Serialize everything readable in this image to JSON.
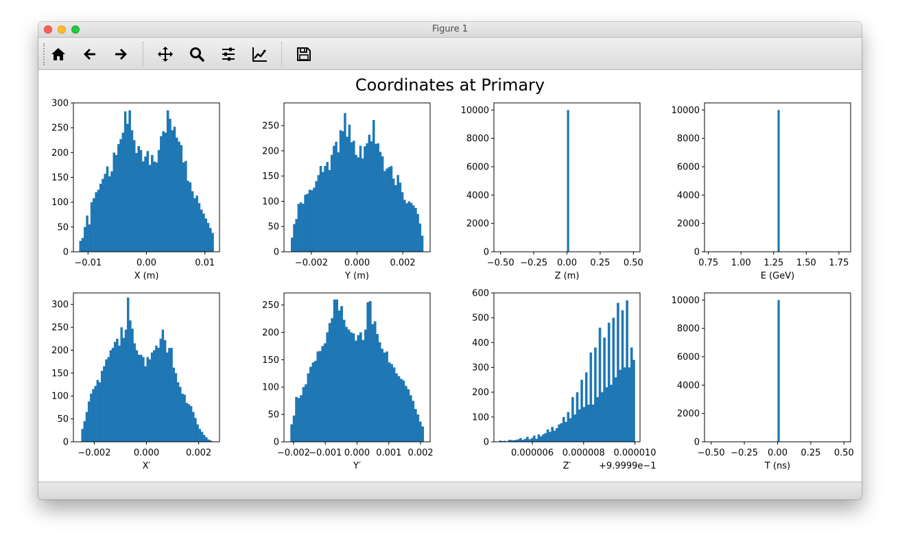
{
  "window": {
    "title": "Figure 1"
  },
  "toolbar": {
    "buttons": [
      {
        "icon": "home-icon"
      },
      {
        "icon": "back-arrow-icon"
      },
      {
        "icon": "forward-arrow-icon"
      },
      {
        "icon": "pan-move-icon"
      },
      {
        "icon": "zoom-magnifier-icon"
      },
      {
        "icon": "configure-subplots-icon"
      },
      {
        "icon": "edit-axis-curve-icon"
      },
      {
        "icon": "save-floppy-icon"
      }
    ]
  },
  "colors": {
    "bar": "#1f77b4"
  },
  "figure": {
    "title": "Coordinates at Primary"
  },
  "chart_data": [
    {
      "type": "bar",
      "xlabel": "X (m)",
      "xlim": [
        -0.0125,
        0.0125
      ],
      "ylim": [
        0,
        300
      ],
      "xticks": [
        -0.01,
        0.0,
        0.01
      ],
      "xticklabels": [
        "−0.01",
        "0.00",
        "0.01"
      ],
      "yticks": [
        0,
        50,
        100,
        150,
        200,
        250,
        300
      ],
      "bins_range": [
        -0.0115,
        0.0115
      ],
      "values": [
        22,
        28,
        50,
        73,
        55,
        100,
        108,
        120,
        125,
        137,
        147,
        157,
        172,
        152,
        162,
        200,
        195,
        217,
        227,
        240,
        283,
        258,
        285,
        245,
        225,
        199,
        213,
        205,
        182,
        192,
        203,
        175,
        195,
        182,
        180,
        205,
        233,
        243,
        240,
        285,
        268,
        245,
        252,
        230,
        222,
        215,
        180,
        183,
        143,
        140,
        122,
        108,
        113,
        98,
        85,
        77,
        67,
        58,
        48,
        38
      ]
    },
    {
      "type": "bar",
      "xlabel": "Y (m)",
      "xlim": [
        -0.0032,
        0.0032
      ],
      "ylim": [
        0,
        295
      ],
      "xticks": [
        -0.002,
        0.0,
        0.002
      ],
      "xticklabels": [
        "−0.002",
        "0.000",
        "0.002"
      ],
      "yticks": [
        0,
        50,
        100,
        150,
        200,
        250
      ],
      "bins_range": [
        -0.0029,
        0.0029
      ],
      "values": [
        28,
        55,
        65,
        95,
        98,
        95,
        113,
        115,
        123,
        122,
        127,
        140,
        152,
        170,
        158,
        170,
        178,
        162,
        192,
        210,
        218,
        197,
        241,
        239,
        275,
        228,
        252,
        217,
        220,
        192,
        187,
        210,
        185,
        209,
        215,
        232,
        219,
        261,
        214,
        215,
        198,
        189,
        160,
        165,
        168,
        170,
        145,
        132,
        152,
        137,
        118,
        103,
        96,
        100,
        97,
        92,
        87,
        75,
        56,
        32
      ]
    },
    {
      "type": "bar",
      "xlabel": "Z (m)",
      "xlim": [
        -0.55,
        0.55
      ],
      "ylim": [
        0,
        10500
      ],
      "xticks": [
        -0.5,
        -0.25,
        0.0,
        0.25,
        0.5
      ],
      "xticklabels": [
        "−0.50",
        "−0.25",
        "0.00",
        "0.25",
        "0.50"
      ],
      "yticks": [
        0,
        2000,
        4000,
        6000,
        8000,
        10000
      ],
      "bins_range": [
        -0.5,
        0.5
      ],
      "spike_at": 0.0,
      "spike_value": 10000,
      "nbins": 60
    },
    {
      "type": "bar",
      "xlabel": "E (GeV)",
      "xlim": [
        0.72,
        1.84
      ],
      "ylim": [
        0,
        10500
      ],
      "xticks": [
        0.75,
        1.0,
        1.25,
        1.5,
        1.75
      ],
      "xticklabels": [
        "0.75",
        "1.00",
        "1.25",
        "1.50",
        "1.75"
      ],
      "yticks": [
        0,
        2000,
        4000,
        6000,
        8000,
        10000
      ],
      "bins_range": [
        0.78,
        1.78
      ],
      "spike_at": 1.28,
      "spike_value": 10000,
      "nbins": 60
    },
    {
      "type": "bar",
      "xlabel": "X′",
      "xlim": [
        -0.0028,
        0.0028
      ],
      "ylim": [
        0,
        325
      ],
      "xticks": [
        -0.002,
        0.0,
        0.002
      ],
      "xticklabels": [
        "−0.002",
        "0.000",
        "0.002"
      ],
      "yticks": [
        0,
        50,
        100,
        150,
        200,
        250,
        300
      ],
      "bins_range": [
        -0.0025,
        0.0025
      ],
      "values": [
        28,
        45,
        65,
        88,
        105,
        115,
        122,
        135,
        130,
        155,
        165,
        180,
        185,
        200,
        205,
        218,
        225,
        210,
        250,
        227,
        245,
        315,
        265,
        247,
        215,
        200,
        190,
        190,
        185,
        165,
        185,
        180,
        195,
        200,
        210,
        205,
        225,
        245,
        222,
        195,
        205,
        205,
        162,
        150,
        130,
        120,
        105,
        103,
        85,
        82,
        78,
        65,
        52,
        38,
        28,
        22,
        15,
        10,
        5,
        3
      ]
    },
    {
      "type": "bar",
      "xlabel": "Y′",
      "xlim": [
        -0.0023,
        0.0023
      ],
      "ylim": [
        0,
        272
      ],
      "xticks": [
        -0.002,
        -0.001,
        0.0,
        0.001,
        0.002
      ],
      "xticklabels": [
        "−0.002",
        "−0.001",
        "0.000",
        "0.001",
        "0.002"
      ],
      "yticks": [
        0,
        50,
        100,
        150,
        200,
        250
      ],
      "bins_range": [
        -0.0021,
        0.0021
      ],
      "values": [
        32,
        48,
        82,
        80,
        85,
        100,
        105,
        125,
        137,
        145,
        148,
        165,
        166,
        175,
        180,
        200,
        217,
        226,
        260,
        260,
        240,
        248,
        223,
        210,
        205,
        200,
        198,
        185,
        195,
        200,
        186,
        205,
        255,
        257,
        215,
        220,
        197,
        182,
        170,
        163,
        165,
        145,
        142,
        136,
        125,
        120,
        115,
        112,
        102,
        96,
        85,
        75,
        60,
        50,
        37,
        28
      ]
    },
    {
      "type": "bar",
      "xlabel": "Z′",
      "offset_text": "+9.9999e−1",
      "xlim": [
        4.5e-06,
        1.02e-05
      ],
      "ylim": [
        0,
        600
      ],
      "xticks": [
        6e-06,
        8e-06,
        1e-05
      ],
      "xticklabels": [
        "0.000006",
        "0.000008",
        "0.000010"
      ],
      "yticks": [
        0,
        100,
        200,
        300,
        400,
        500,
        600
      ],
      "bins_range": [
        4.7e-06,
        1e-05
      ],
      "values": [
        5,
        3,
        4,
        2,
        8,
        7,
        6,
        8,
        10,
        15,
        8,
        12,
        20,
        10,
        15,
        25,
        12,
        30,
        22,
        30,
        35,
        50,
        40,
        60,
        45,
        55,
        70,
        75,
        100,
        80,
        120,
        95,
        180,
        110,
        200,
        130,
        250,
        140,
        280,
        150,
        360,
        150,
        380,
        180,
        460,
        200,
        420,
        220,
        480,
        230,
        500,
        260,
        560,
        290,
        530,
        300,
        570,
        300,
        380,
        330
      ]
    },
    {
      "type": "bar",
      "xlabel": "T (ns)",
      "xlim": [
        -0.55,
        0.55
      ],
      "ylim": [
        0,
        10500
      ],
      "xticks": [
        -0.5,
        -0.25,
        0.0,
        0.25,
        0.5
      ],
      "xticklabels": [
        "−0.50",
        "−0.25",
        "0.00",
        "0.25",
        "0.50"
      ],
      "yticks": [
        0,
        2000,
        4000,
        6000,
        8000,
        10000
      ],
      "bins_range": [
        -0.5,
        0.5
      ],
      "spike_at": 0.0,
      "spike_value": 10000,
      "nbins": 60
    }
  ]
}
